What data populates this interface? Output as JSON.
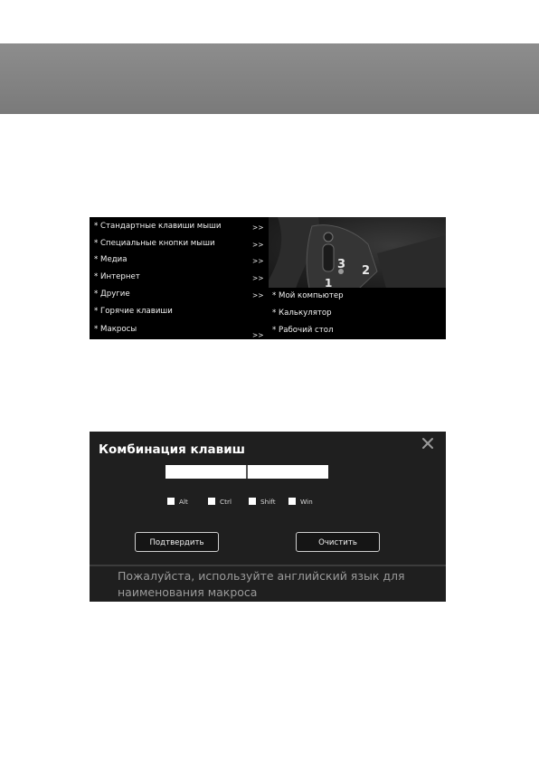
{
  "menu": {
    "items": [
      {
        "label": "* Стандартные клавиши мыши",
        "arrow": ">>"
      },
      {
        "label": "* Специальные кнопки мыши",
        "arrow": ">>"
      },
      {
        "label": "* Медиа",
        "arrow": ">>"
      },
      {
        "label": "* Интернет",
        "arrow": ">>"
      },
      {
        "label": "* Другие",
        "arrow": ">>"
      },
      {
        "label": "* Горячие клавиши",
        "arrow": ""
      },
      {
        "label": "* Макросы",
        "arrow": ">>"
      }
    ],
    "submenu": [
      {
        "label": "* Мой компьютер"
      },
      {
        "label": "* Калькулятор"
      },
      {
        "label": "* Рабочий стол"
      }
    ],
    "photo_numbers": [
      "3",
      "2",
      "1"
    ]
  },
  "dialog": {
    "title": "Комбинация клавиш",
    "close_symbol": "✕",
    "key_field_1": "",
    "key_field_2": "",
    "modifiers": [
      {
        "label": "Alt",
        "checked": false
      },
      {
        "label": "Ctrl",
        "checked": false
      },
      {
        "label": "Shift",
        "checked": false
      },
      {
        "label": "Win",
        "checked": false
      }
    ],
    "confirm_label": "Подтвердить",
    "clear_label": "Очистить",
    "note": "Пожалуйста, используйте английский язык для наименования макроса"
  },
  "colors": {
    "header_band": "#838383",
    "menu_bg": "#000000",
    "dialog_bg": "#1f1f1f",
    "note_text": "#9a9a9a"
  }
}
